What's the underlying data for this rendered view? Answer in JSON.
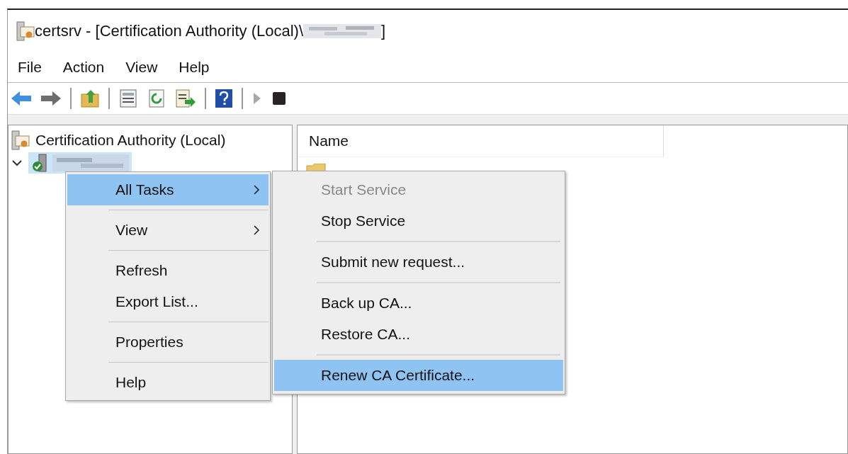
{
  "window": {
    "title": "certsrv - [Certification Authority (Local)\\",
    "title_end": "]"
  },
  "menu_bar": [
    "File",
    "Action",
    "View",
    "Help"
  ],
  "toolbar": [
    {
      "kind": "back"
    },
    {
      "kind": "forward"
    },
    {
      "kind": "sep"
    },
    {
      "kind": "up"
    },
    {
      "kind": "sep"
    },
    {
      "kind": "properties"
    },
    {
      "kind": "refresh"
    },
    {
      "kind": "export"
    },
    {
      "kind": "sep"
    },
    {
      "kind": "help"
    },
    {
      "kind": "sep"
    },
    {
      "kind": "play",
      "disabled": true
    },
    {
      "kind": "stop",
      "disabled": false
    }
  ],
  "tree": {
    "root": "Certification Authority (Local)",
    "server": {
      "expanded": true,
      "selected": true
    }
  },
  "list": {
    "columns": [
      "Name"
    ]
  },
  "context_menu": [
    {
      "kind": "item",
      "label": "All Tasks",
      "submenu": true,
      "selected": true
    },
    {
      "kind": "separator"
    },
    {
      "kind": "item",
      "label": "View",
      "submenu": true,
      "selected": false
    },
    {
      "kind": "separator"
    },
    {
      "kind": "item",
      "label": "Refresh",
      "submenu": false,
      "selected": false
    },
    {
      "kind": "item",
      "label": "Export List...",
      "submenu": false,
      "selected": false
    },
    {
      "kind": "separator"
    },
    {
      "kind": "item",
      "label": "Properties",
      "submenu": false,
      "selected": false
    },
    {
      "kind": "separator"
    },
    {
      "kind": "item",
      "label": "Help",
      "submenu": false,
      "selected": false
    }
  ],
  "submenu": [
    {
      "kind": "item",
      "label": "Start Service",
      "disabled": true,
      "selected": false
    },
    {
      "kind": "item",
      "label": "Stop Service",
      "disabled": false,
      "selected": false
    },
    {
      "kind": "separator"
    },
    {
      "kind": "item",
      "label": "Submit new request...",
      "disabled": false,
      "selected": false
    },
    {
      "kind": "separator"
    },
    {
      "kind": "item",
      "label": "Back up CA...",
      "disabled": false,
      "selected": false
    },
    {
      "kind": "item",
      "label": "Restore CA...",
      "disabled": false,
      "selected": false
    },
    {
      "kind": "separator"
    },
    {
      "kind": "item",
      "label": "Renew CA Certificate...",
      "disabled": false,
      "selected": true
    }
  ]
}
